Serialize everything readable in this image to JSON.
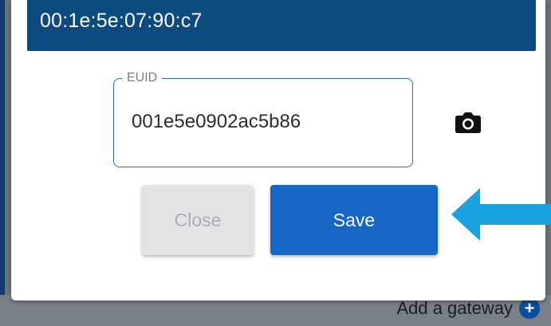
{
  "dialog": {
    "mac_address": "00:1e:5e:07:90:c7",
    "euid_label": "EUID",
    "euid_value": "001e5e0902ac5b86",
    "close_label": "Close",
    "save_label": "Save"
  },
  "background": {
    "add_gateway_label": "Add a gateway",
    "add_icon": "plus-circle-icon"
  },
  "icons": {
    "camera": "camera-icon",
    "arrow": "arrow-left-icon"
  },
  "colors": {
    "header": "#0d4a80",
    "primary": "#1566c5",
    "disabled": "#e3e4e6",
    "field_border": "#2f6fb0",
    "arrow": "#1aa3e0"
  }
}
